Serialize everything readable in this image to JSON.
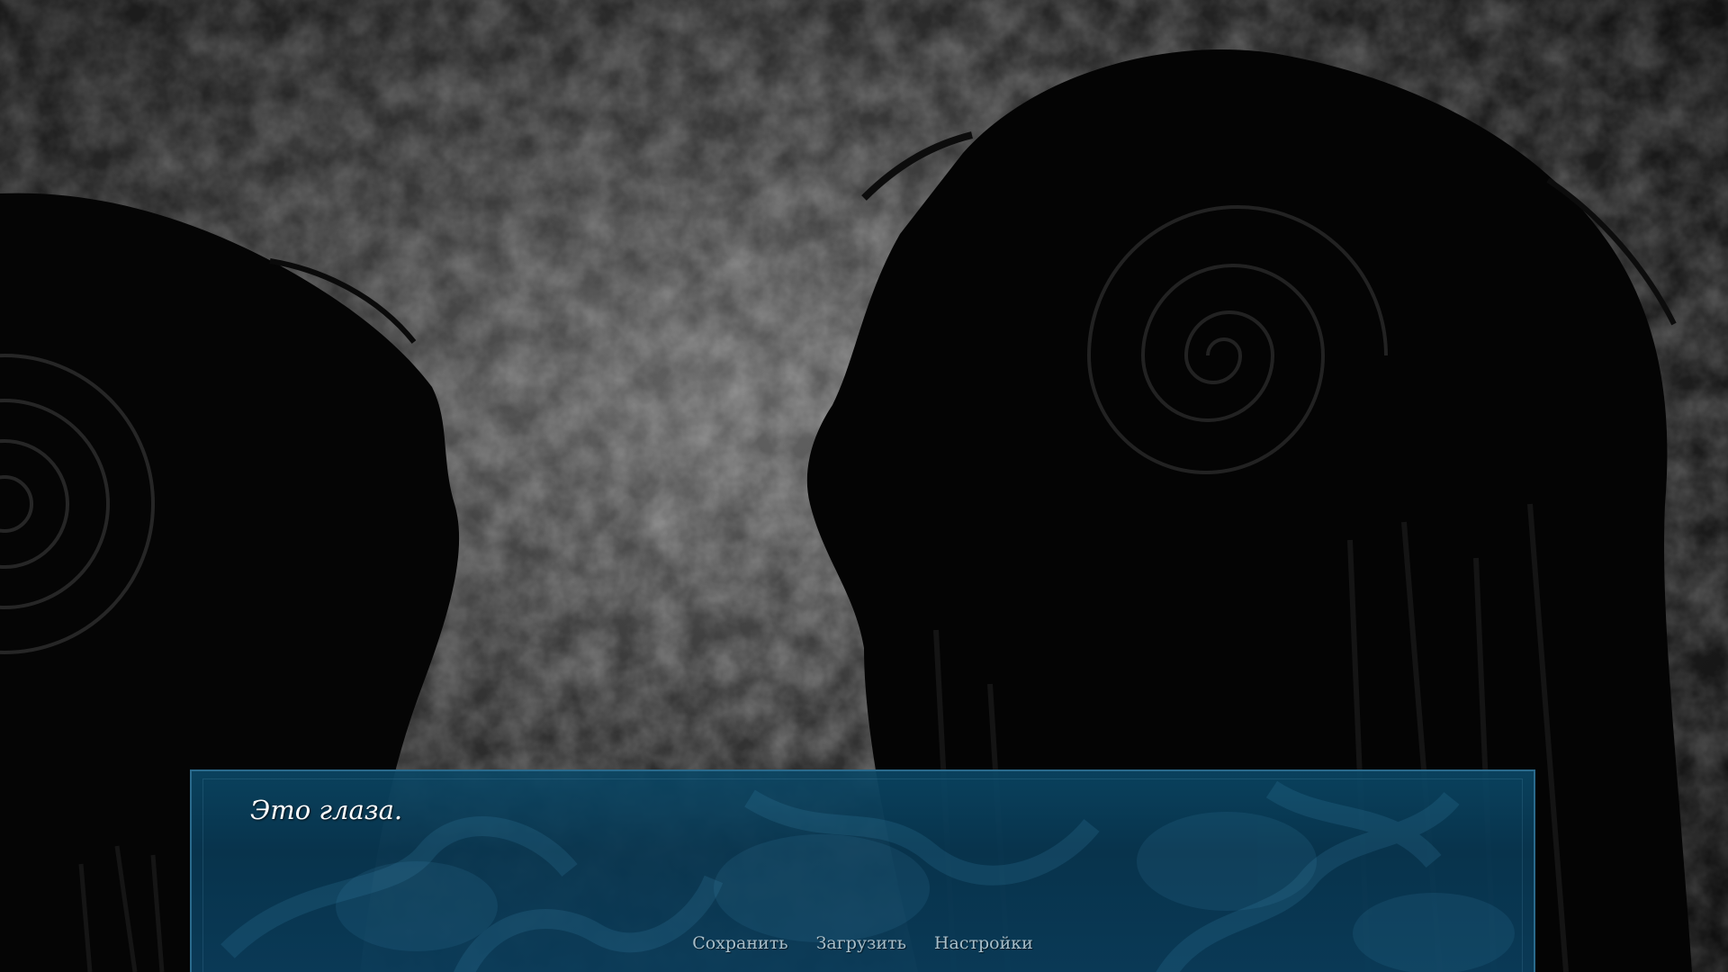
{
  "dialogue": {
    "text": "Это глаза."
  },
  "quick_menu": {
    "save_label": "Сохранить",
    "load_label": "Загрузить",
    "settings_label": "Настройки"
  },
  "colors": {
    "textbox_bg": "#0a4664",
    "textbox_border": "#2a6a8c",
    "menu_text": "#a9bfca",
    "dialogue_text": "#ffffff"
  }
}
